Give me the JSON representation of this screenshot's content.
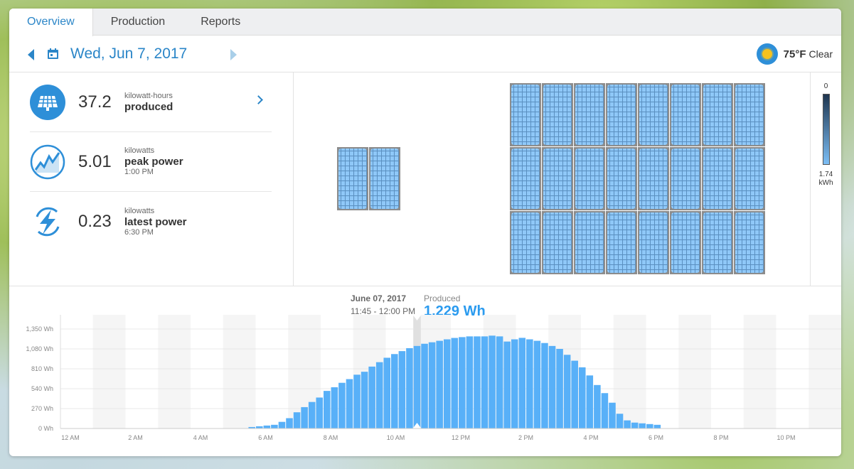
{
  "tabs": [
    {
      "label": "Overview",
      "active": true
    },
    {
      "label": "Production",
      "active": false
    },
    {
      "label": "Reports",
      "active": false
    }
  ],
  "date": "Wed, Jun 7, 2017",
  "weather": {
    "temp": "75°F",
    "condition": "Clear"
  },
  "stats": [
    {
      "value": "37.2",
      "unit": "kilowatt-hours",
      "label": "produced",
      "time": ""
    },
    {
      "value": "5.01",
      "unit": "kilowatts",
      "label": "peak power",
      "time": "1:00 PM"
    },
    {
      "value": "0.23",
      "unit": "kilowatts",
      "label": "latest power",
      "time": "6:30 PM"
    }
  ],
  "legend": {
    "top": "0",
    "bottom_value": "1.74",
    "bottom_unit": "kWh"
  },
  "tooltip": {
    "date": "June 07, 2017",
    "range": "11:45 - 12:00 PM",
    "label": "Produced",
    "value": "1,229 Wh"
  },
  "colors": {
    "accent": "#2b86c8",
    "bar": "#58b0f8",
    "value": "#2b9bef"
  },
  "chart_data": {
    "type": "bar",
    "y_ticks": [
      "1,350 Wh",
      "1,080 Wh",
      "810 Wh",
      "540 Wh",
      "270 Wh",
      "0 Wh"
    ],
    "x_ticks": [
      "12 AM",
      "2 AM",
      "4 AM",
      "6 AM",
      "8 AM",
      "10 AM",
      "12 PM",
      "2 PM",
      "4 PM",
      "6 PM",
      "8 PM",
      "10 PM"
    ],
    "ylim": [
      0,
      1350
    ],
    "interval": "15 min",
    "values": [
      0,
      0,
      0,
      0,
      0,
      0,
      0,
      0,
      0,
      0,
      0,
      0,
      0,
      0,
      0,
      0,
      0,
      0,
      0,
      0,
      0,
      0,
      0,
      0,
      5,
      20,
      30,
      40,
      50,
      90,
      140,
      220,
      290,
      360,
      420,
      510,
      560,
      620,
      670,
      730,
      770,
      840,
      900,
      960,
      1010,
      1050,
      1090,
      1120,
      1150,
      1170,
      1190,
      1210,
      1229,
      1240,
      1250,
      1250,
      1250,
      1260,
      1250,
      1180,
      1210,
      1230,
      1210,
      1190,
      1160,
      1120,
      1080,
      1000,
      920,
      830,
      720,
      590,
      480,
      350,
      200,
      110,
      80,
      70,
      60,
      50,
      0,
      0,
      0,
      0,
      0,
      0,
      0,
      0,
      0,
      0,
      0,
      0,
      0,
      0,
      0,
      0,
      0,
      0,
      0,
      0,
      0,
      0,
      0,
      0
    ]
  }
}
